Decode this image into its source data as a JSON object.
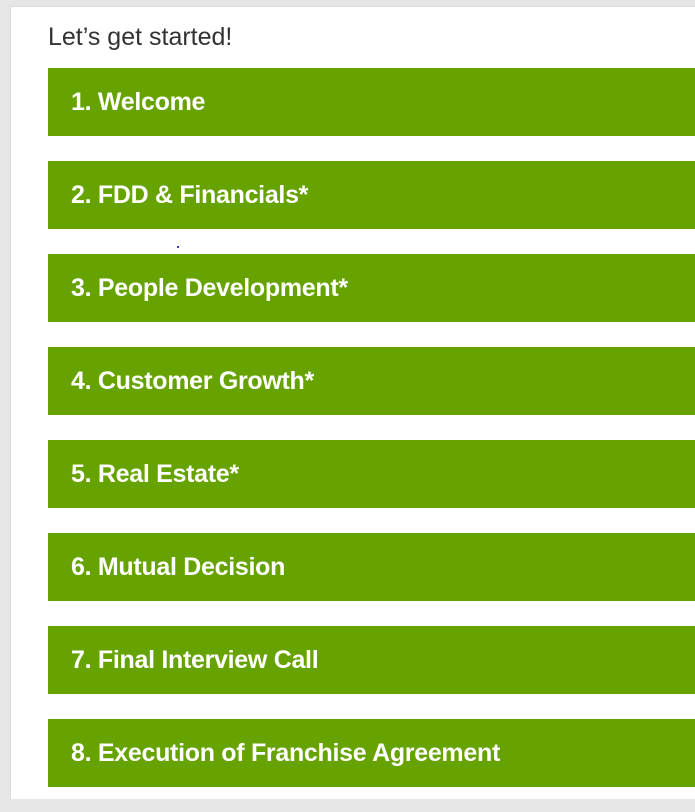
{
  "page": {
    "heading": "Let’s get started!"
  },
  "steps": [
    {
      "label": "1. Welcome"
    },
    {
      "label": "2. FDD & Financials*"
    },
    {
      "label": "3. People Development*"
    },
    {
      "label": "4. Customer Growth*"
    },
    {
      "label": "5. Real Estate*"
    },
    {
      "label": "6. Mutual Decision"
    },
    {
      "label": "7. Final Interview Call"
    },
    {
      "label": "8. Execution of Franchise Agreement"
    }
  ],
  "colors": {
    "step_background": "#66a300",
    "step_text": "#ffffff",
    "heading_text": "#333333",
    "page_background": "#e6e6e6"
  }
}
